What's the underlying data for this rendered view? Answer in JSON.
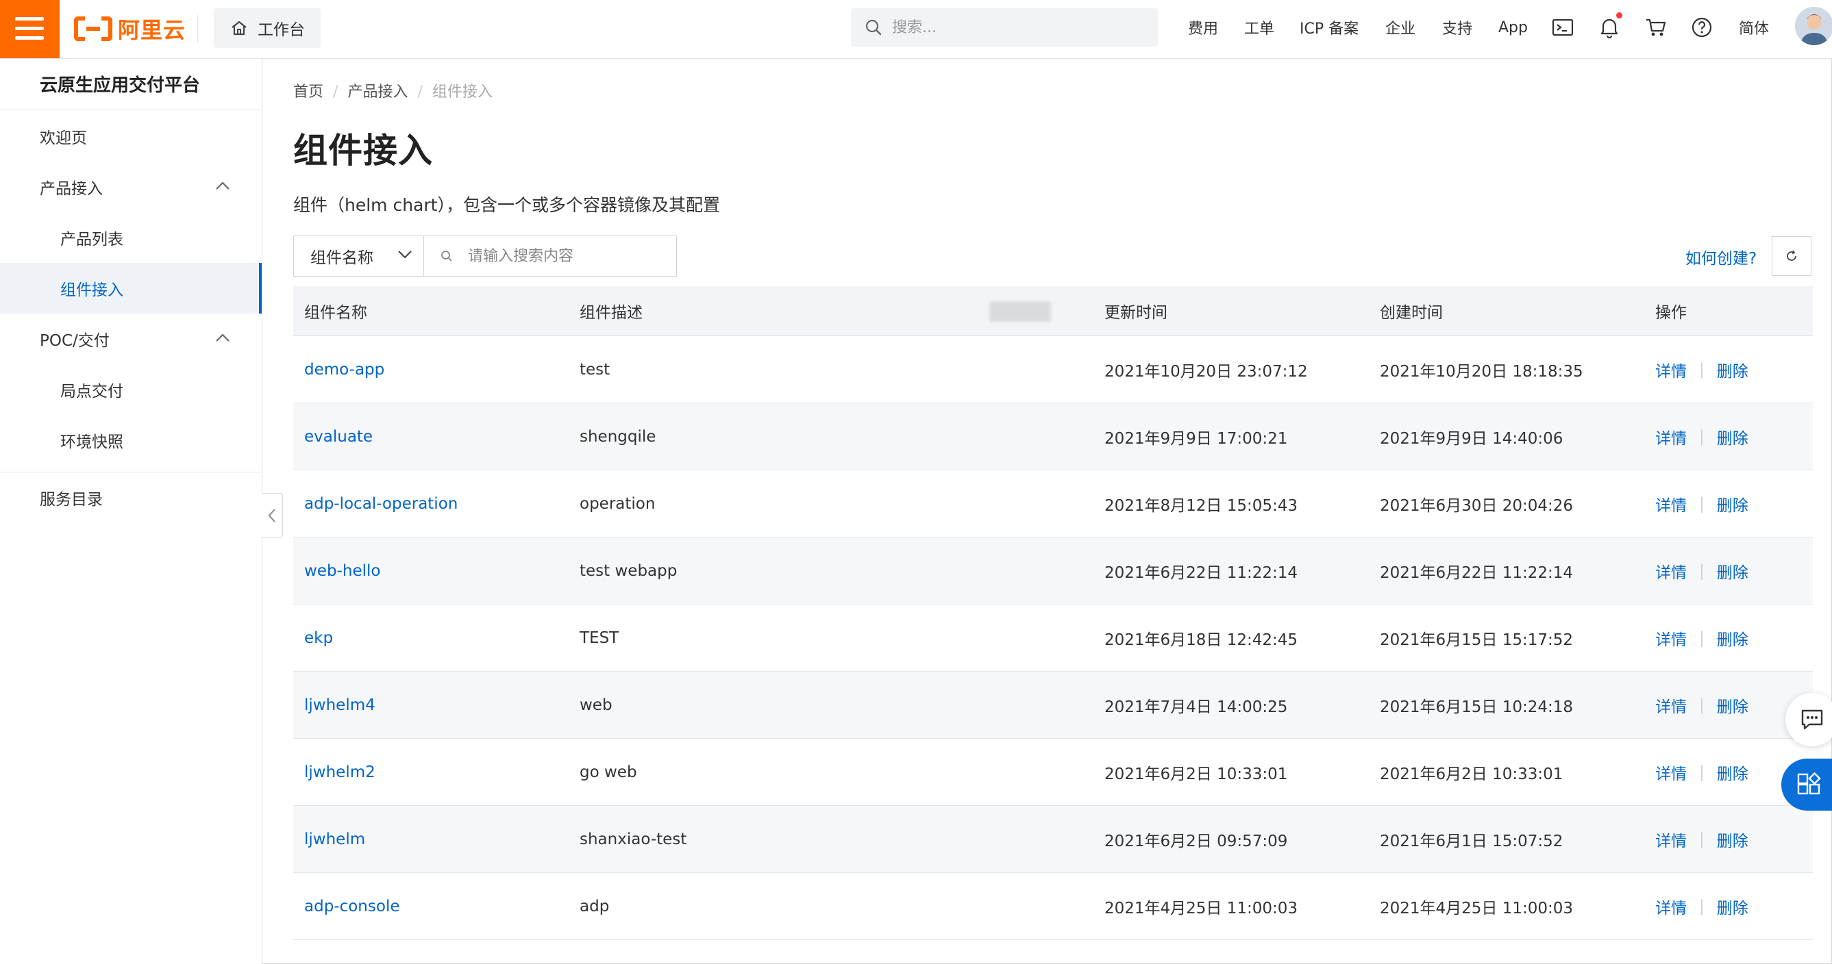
{
  "brand": {
    "name": "阿里云",
    "accent": "#ff6a00",
    "link_color": "#0064c8"
  },
  "topbar": {
    "workbench_label": "工作台",
    "search_placeholder": "搜索...",
    "nav": [
      "费用",
      "工单",
      "ICP 备案",
      "企业",
      "支持",
      "App"
    ],
    "icons": [
      "terminal-icon",
      "bell-icon",
      "cart-icon",
      "help-icon"
    ],
    "language": "简体"
  },
  "sidebar": {
    "title": "云原生应用交付平台",
    "items": [
      {
        "label": "欢迎页",
        "level": 1
      },
      {
        "label": "产品接入",
        "level": 1,
        "expanded": true
      },
      {
        "label": "产品列表",
        "level": 2
      },
      {
        "label": "组件接入",
        "level": 2,
        "active": true
      },
      {
        "label": "POC/交付",
        "level": 1,
        "expanded": true
      },
      {
        "label": "局点交付",
        "level": 2
      },
      {
        "label": "环境快照",
        "level": 2
      },
      {
        "label": "服务目录",
        "level": 1
      }
    ]
  },
  "breadcrumb": [
    "首页",
    "产品接入",
    "组件接入"
  ],
  "page": {
    "title": "组件接入",
    "description": "组件（helm chart），包含一个或多个容器镜像及其配置"
  },
  "filter": {
    "field": "组件名称",
    "placeholder": "请输入搜索内容",
    "howto_link": "如何创建?"
  },
  "table": {
    "columns": [
      "组件名称",
      "组件描述",
      "更新时间",
      "创建时间",
      "操作"
    ],
    "actions": {
      "detail": "详情",
      "delete": "删除"
    },
    "rows": [
      {
        "name": "demo-app",
        "desc": "test",
        "updated": "2021年10月20日 23:07:12",
        "created": "2021年10月20日 18:18:35"
      },
      {
        "name": "evaluate",
        "desc": "shengqile",
        "updated": "2021年9月9日 17:00:21",
        "created": "2021年9月9日 14:40:06"
      },
      {
        "name": "adp-local-operation",
        "desc": "operation",
        "updated": "2021年8月12日 15:05:43",
        "created": "2021年6月30日 20:04:26"
      },
      {
        "name": "web-hello",
        "desc": "test webapp",
        "updated": "2021年6月22日 11:22:14",
        "created": "2021年6月22日 11:22:14"
      },
      {
        "name": "ekp",
        "desc": "TEST",
        "updated": "2021年6月18日 12:42:45",
        "created": "2021年6月15日 15:17:52"
      },
      {
        "name": "ljwhelm4",
        "desc": "web",
        "updated": "2021年7月4日 14:00:25",
        "created": "2021年6月15日 10:24:18"
      },
      {
        "name": "ljwhelm2",
        "desc": "go web",
        "updated": "2021年6月2日 10:33:01",
        "created": "2021年6月2日 10:33:01"
      },
      {
        "name": "ljwhelm",
        "desc": "shanxiao-test",
        "updated": "2021年6月2日 09:57:09",
        "created": "2021年6月1日 15:07:52"
      },
      {
        "name": "adp-console",
        "desc": "adp",
        "updated": "2021年4月25日 11:00:03",
        "created": "2021年4月25日 11:00:03"
      }
    ]
  },
  "floating": [
    "chat-icon",
    "apps-icon"
  ]
}
